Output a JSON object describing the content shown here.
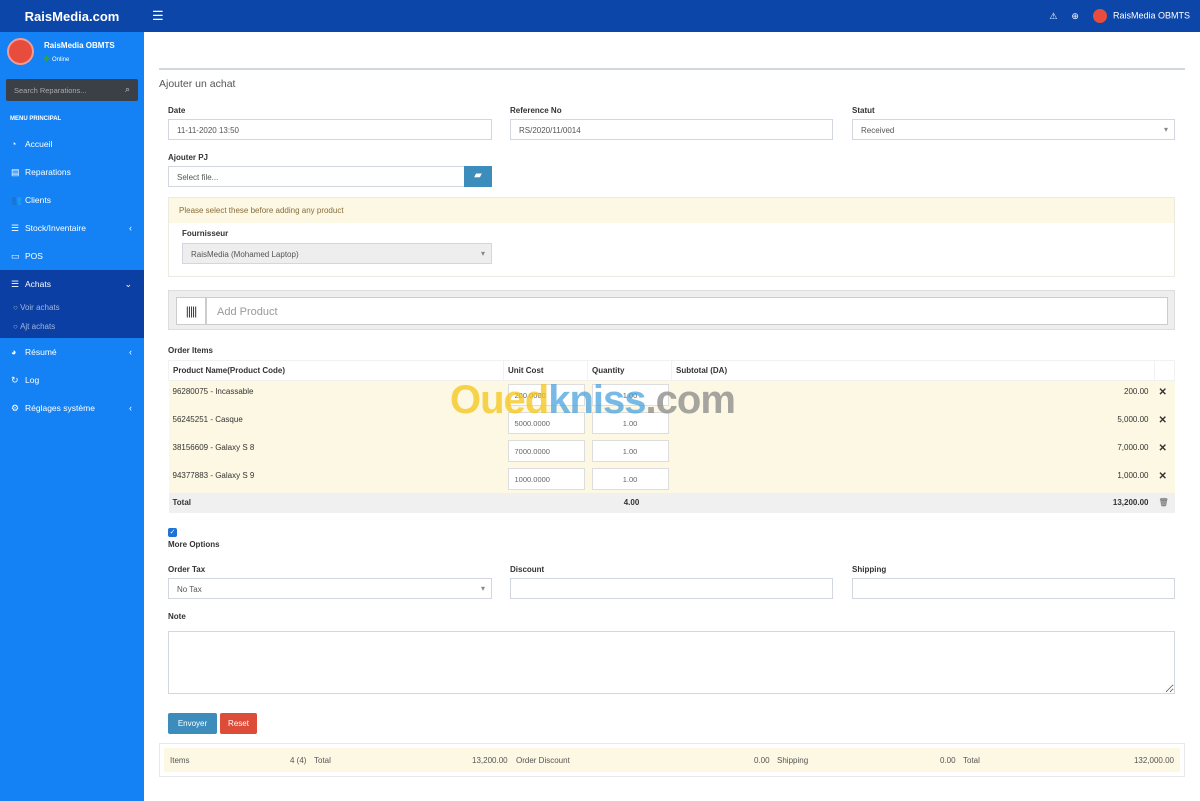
{
  "topbar": {
    "brand": "RaisMedia.com",
    "user": "RaisMedia OBMTS"
  },
  "sidebar": {
    "user_name": "RaisMedia OBMTS",
    "status": "Online",
    "search_placeholder": "Search Reparations...",
    "menu_header": "MENU PRINCIPAL",
    "items": [
      {
        "label": "Accueil",
        "icon": "dashboard-icon"
      },
      {
        "label": "Reparations",
        "icon": "list-icon"
      },
      {
        "label": "Clients",
        "icon": "users-icon"
      },
      {
        "label": "Stock/Inventaire",
        "icon": "tasks-icon"
      },
      {
        "label": "POS",
        "icon": "desktop-icon"
      },
      {
        "label": "Achats",
        "icon": "tasks-icon"
      },
      {
        "label": "Résumé",
        "icon": "pie-chart-icon"
      },
      {
        "label": "Log",
        "icon": "refresh-icon"
      },
      {
        "label": "Réglages système",
        "icon": "gear-icon"
      }
    ],
    "sub_items": [
      "Voir achats",
      "Ajt achats"
    ]
  },
  "form": {
    "title": "Ajouter un achat",
    "date_label": "Date",
    "date": "11-11-2020 13:50",
    "ref_label": "Reference No",
    "ref": "RS/2020/11/0014",
    "status_label": "Statut",
    "status": "Received",
    "pj_label": "Ajouter PJ",
    "pj_placeholder": "Select file...",
    "warning": "Please select these before adding any product",
    "supplier_label": "Fournisseur",
    "supplier": "RaisMedia (Mohamed Laptop)",
    "add_product_placeholder": "Add Product",
    "order_items_label": "Order Items",
    "columns": [
      "Product Name(Product Code)",
      "Unit Cost",
      "Quantity",
      "Subtotal (DA)"
    ],
    "rows": [
      {
        "name": "96280075 - Incassable",
        "cost": "200.0000",
        "qty": "1.00",
        "subtotal": "200.00"
      },
      {
        "name": "56245251 - Casque",
        "cost": "5000.0000",
        "qty": "1.00",
        "subtotal": "5,000.00"
      },
      {
        "name": "38156609 - Galaxy S 8",
        "cost": "7000.0000",
        "qty": "1.00",
        "subtotal": "7,000.00"
      },
      {
        "name": "94377883 - Galaxy S 9",
        "cost": "1000.0000",
        "qty": "1.00",
        "subtotal": "1,000.00"
      }
    ],
    "total_label": "Total",
    "total_qty": "4.00",
    "total_subtotal": "13,200.00",
    "more_options": "More Options",
    "tax_label": "Order Tax",
    "tax": "No Tax",
    "discount_label": "Discount",
    "shipping_label": "Shipping",
    "note_label": "Note",
    "submit": "Envoyer",
    "reset": "Reset"
  },
  "footer": {
    "items_label": "Items",
    "items": "4 (4)",
    "total_label": "Total",
    "total": "13,200.00",
    "discount_label": "Order Discount",
    "discount": "0.00",
    "shipping_label": "Shipping",
    "shipping": "0.00",
    "grand_label": "Total",
    "grand": "132,000.00"
  },
  "watermark": "Ouedkniss.com"
}
